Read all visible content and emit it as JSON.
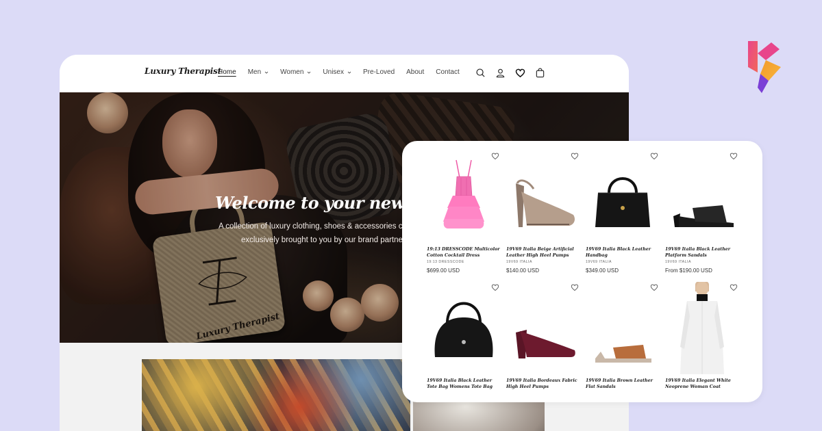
{
  "header": {
    "logo": "Luxury Therapist",
    "nav": [
      {
        "label": "Home",
        "active": true,
        "dropdown": false
      },
      {
        "label": "Men",
        "active": false,
        "dropdown": true
      },
      {
        "label": "Women",
        "active": false,
        "dropdown": true
      },
      {
        "label": "Unisex",
        "active": false,
        "dropdown": true
      },
      {
        "label": "Pre-Loved",
        "active": false,
        "dropdown": false
      },
      {
        "label": "About",
        "active": false,
        "dropdown": false
      },
      {
        "label": "Contact",
        "active": false,
        "dropdown": false
      }
    ],
    "icons": [
      "search-icon",
      "account-icon",
      "wishlist-heart-icon",
      "cart-icon"
    ]
  },
  "hero": {
    "title": "Welcome to your new happ",
    "subtitle_line1": "A collection of luxury clothing, shoes & accessories ca",
    "subtitle_line2": "exclusively brought to you by our brand partne",
    "bag_text": "Luxury Therapist"
  },
  "products": [
    {
      "name": "19:13 DRESSCODE Multicolor Cotton Cocktail Dress",
      "vendor": "19:13 DRESSCODE",
      "price": "$699.00 USD",
      "thumb": "pink-dress"
    },
    {
      "name": "19V69 Italia Beige Artificial Leather High Heel Pumps",
      "vendor": "19V69 ITALIA",
      "price": "$140.00 USD",
      "thumb": "beige-pumps"
    },
    {
      "name": "19V69 Italia Black Leather Handbag",
      "vendor": "19V69 ITALIA",
      "price": "$349.00 USD",
      "thumb": "black-handbag"
    },
    {
      "name": "19V69 Italia Black Leather Platform Sandals",
      "vendor": "19V69 ITALIA",
      "price": "From $190.00 USD",
      "thumb": "black-sandals"
    },
    {
      "name": "19V69 Italia Black Leather Tote Bag Womens Tote Bag",
      "vendor": "",
      "price": "",
      "thumb": "black-tote"
    },
    {
      "name": "19V69 Italia Bordeaux Fabric High Heel Pumps",
      "vendor": "",
      "price": "",
      "thumb": "bordeaux-pumps"
    },
    {
      "name": "19V69 Italia Brown Leather Flat Sandals",
      "vendor": "",
      "price": "",
      "thumb": "brown-sandals"
    },
    {
      "name": "19V69 Italia Elegant White Neoprene Woman Coat",
      "vendor": "",
      "price": "",
      "thumb": "white-coat"
    }
  ],
  "colors": {
    "background": "#dcdbf7",
    "brand_pink": "#e8458b",
    "brand_orange": "#f39a2b",
    "brand_purple": "#7b3fd6"
  }
}
